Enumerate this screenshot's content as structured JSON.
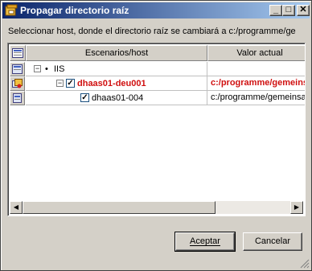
{
  "window": {
    "title": "Propagar directorio raíz",
    "controls": {
      "minimize": "_",
      "maximize": "□",
      "close": "✕"
    }
  },
  "instruction": "Seleccionar host, donde el directorio raíz se cambiará a c:/programme/ge",
  "grid": {
    "columns": [
      "Escenarios/host",
      "Valor actual"
    ],
    "rows": [
      {
        "name": "IIS",
        "value": "",
        "expander": "−",
        "highlight": false,
        "checked": null
      },
      {
        "name": "dhaas01-deu001",
        "value": "c:/programme/gemeins",
        "expander": "−",
        "highlight": true,
        "checked": true
      },
      {
        "name": "dhaas01-004",
        "value": "c:/programme/gemeinsa",
        "expander": null,
        "highlight": false,
        "checked": true
      }
    ]
  },
  "buttons": {
    "accept": "Aceptar",
    "cancel": "Cancelar"
  },
  "colors": {
    "highlight": "#d01010",
    "titlebar_start": "#0a246a",
    "titlebar_end": "#a6caf0"
  }
}
